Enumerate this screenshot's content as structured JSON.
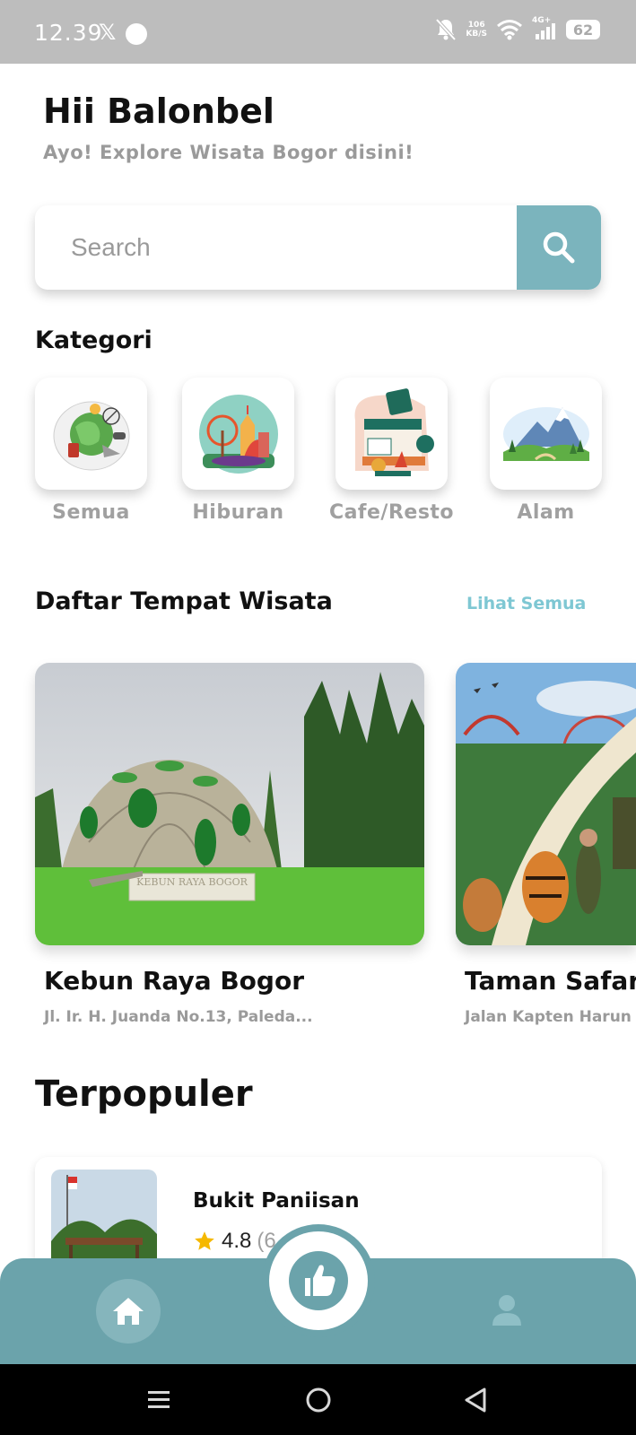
{
  "status_bar": {
    "time": "12.39",
    "x_glyph": "𝕏",
    "net_speed_value": "106",
    "net_speed_unit": "KB/S",
    "signal_label": "4G+",
    "battery": "62"
  },
  "header": {
    "greeting": "Hii Balonbel",
    "subtitle": "Ayo! Explore Wisata Bogor disini!"
  },
  "search": {
    "placeholder": "Search"
  },
  "categories": {
    "title": "Kategori",
    "items": [
      {
        "label": "Semua",
        "icon": "world-travel-icon"
      },
      {
        "label": "Hiburan",
        "icon": "amusement-park-icon"
      },
      {
        "label": "Cafe/Resto",
        "icon": "cafe-shop-icon"
      },
      {
        "label": "Alam",
        "icon": "mountain-nature-icon"
      }
    ]
  },
  "places": {
    "title": "Daftar Tempat Wisata",
    "see_all": "Lihat Semua",
    "items": [
      {
        "name": "Kebun Raya Bogor",
        "address": "Jl. Ir. H. Juanda No.13, Paleda...",
        "sign": "KEBUN RAYA BOGOR"
      },
      {
        "name": "Taman Safari",
        "address": "Jalan Kapten Harun"
      }
    ]
  },
  "popular": {
    "title": "Terpopuler",
    "items": [
      {
        "name": "Bukit Paniisan",
        "rating": "4.8",
        "count": "(6"
      }
    ]
  },
  "bottom_nav": {
    "items": [
      "home-icon",
      "thumbs-up-icon",
      "profile-icon"
    ]
  },
  "colors": {
    "accent": "#7bb4bd",
    "nav_bg": "#6ba3ab",
    "link": "#7ec7d3",
    "muted_text": "#9a9a9a"
  }
}
